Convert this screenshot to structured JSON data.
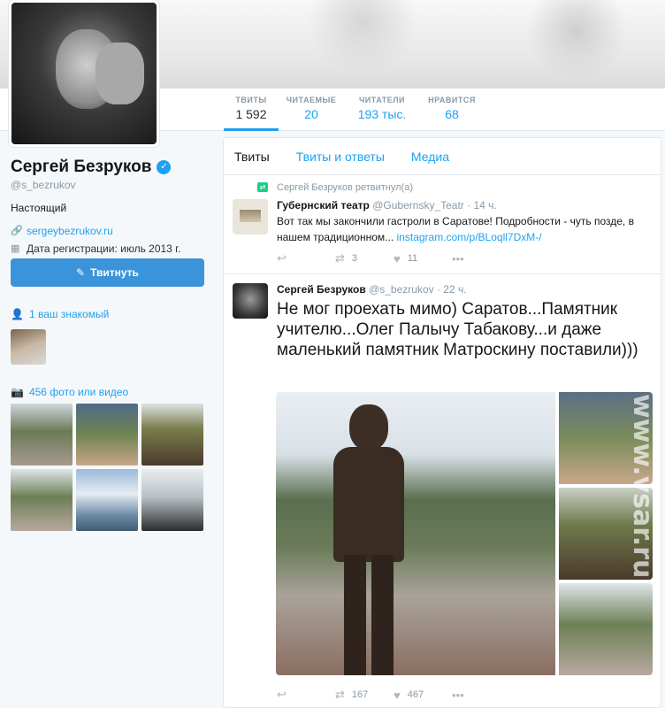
{
  "stats": [
    {
      "label": "ТВИТЫ",
      "value": "1 592"
    },
    {
      "label": "ЧИТАЕМЫЕ",
      "value": "20"
    },
    {
      "label": "ЧИТАТЕЛИ",
      "value": "193 тыс."
    },
    {
      "label": "НРАВИТСЯ",
      "value": "68"
    }
  ],
  "profile": {
    "name": "Сергей Безруков",
    "handle": "@s_bezrukov",
    "bio": "Настоящий",
    "website": "sergeybezrukov.ru",
    "joined": "Дата регистрации: июль 2013 г."
  },
  "tweet_button": "Твитнуть",
  "followers_you_know": "1 ваш знакомый",
  "photos_label": "456 фото или видео",
  "tabs": [
    "Твиты",
    "Твиты и ответы",
    "Медиа"
  ],
  "tweets": [
    {
      "retweet_line": "Сергей Безруков ретвитнул(а)",
      "name": "Губернский театр",
      "handle": "@Gubernsky_Teatr",
      "time": "14 ч.",
      "text": "Вот так мы закончили гастроли в Саратове! Подробности - чуть позде, в нашем традиционном...",
      "link": "instagram.com/p/BLoqll7DxM-/",
      "retweets": "3",
      "likes": "11"
    },
    {
      "name": "Сергей Безруков",
      "handle": "@s_bezrukov",
      "time": "22 ч.",
      "text": "Не мог проехать мимо) Саратов...Памятник учителю...Олег Палычу Табакову...и даже маленький памятник Матроскину поставили)))",
      "retweets": "167",
      "likes": "467"
    }
  ],
  "watermark": "www.vsar.ru",
  "icons": {
    "verified": "verified-badge-icon",
    "link": "link-icon",
    "calendar": "calendar-icon",
    "person": "person-icon",
    "camera": "camera-icon",
    "compose": "compose-icon",
    "reply": "reply-icon",
    "retweet": "retweet-icon",
    "like": "heart-icon",
    "more": "more-icon"
  },
  "colors": {
    "accent": "#1da1f2",
    "button": "#3b94d9",
    "retweet_green": "#19cf86"
  }
}
